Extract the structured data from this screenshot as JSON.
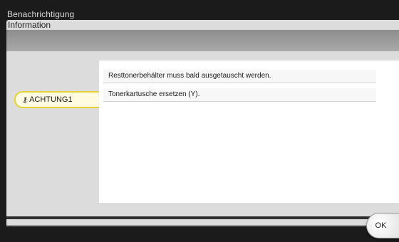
{
  "header": {
    "title": "Benachrichtigung"
  },
  "panel": {
    "title": "Information"
  },
  "tabs": [
    {
      "label": "ACHTUNG1",
      "icon": "key-icon"
    }
  ],
  "messages": [
    "Resttonerbehälter muss bald ausgetauscht werden.",
    "Tonerkartusche ersetzen (Y)."
  ],
  "buttons": {
    "ok_label": "OK"
  },
  "colors": {
    "tab_border": "#e6d238",
    "tab_background": "#fffbe0",
    "background": "#1b1b1b"
  }
}
